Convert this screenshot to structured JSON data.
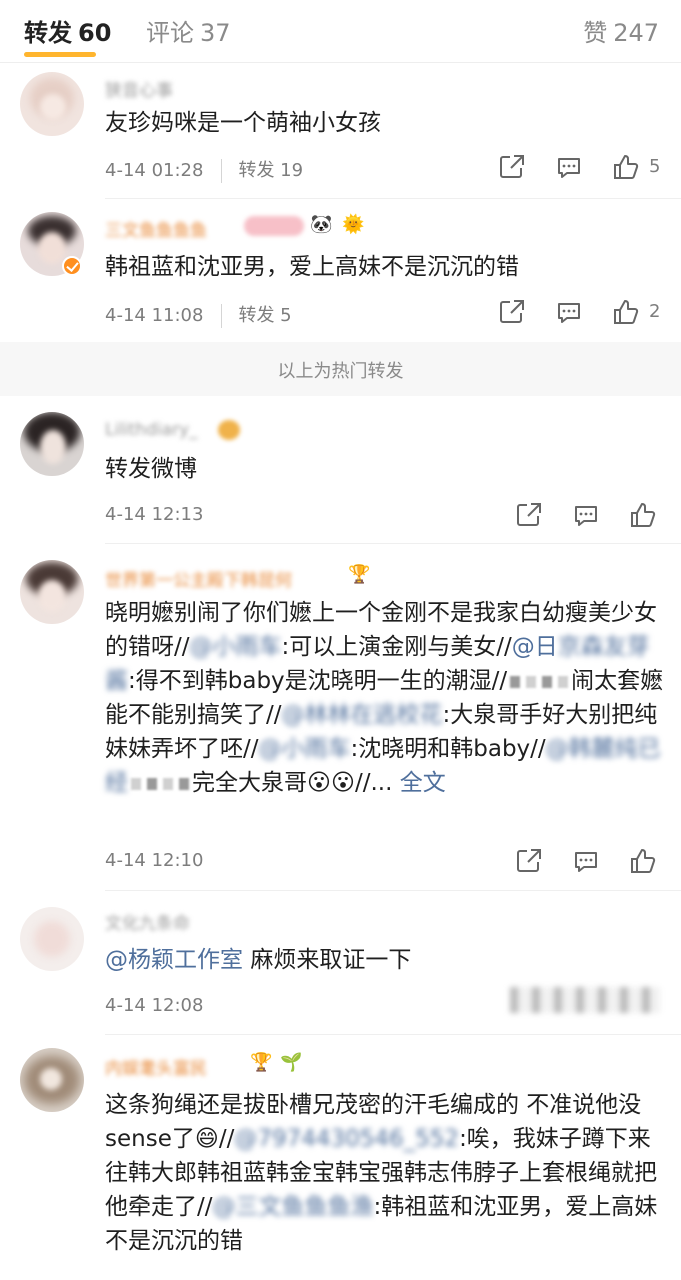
{
  "tabs": {
    "repost_label": "转发",
    "repost_count": "60",
    "comment_label": "评论",
    "comment_count": "37",
    "like_label": "赞",
    "like_count": "247"
  },
  "section_label": "以上为热门转发",
  "colors": {
    "accent_underline": "#ffb52e",
    "mention_blue": "#4f6f9c",
    "meta_gray": "#7d7d7d",
    "verified_orange": "#ff8f1f"
  },
  "posts": [
    {
      "username": "狭音心事",
      "text": "友珍妈咪是一个萌袖小女孩",
      "time": "4-14 01:28",
      "repost": "转发 19",
      "likes": "5"
    },
    {
      "username": "三文鱼鱼鱼鱼",
      "text": "韩祖蓝和沈亚男，爱上高妹不是沉沉的错",
      "time": "4-14 11:08",
      "repost": "转发 5",
      "likes": "2"
    },
    {
      "username": "Lilithdiary_",
      "text": "转发微博",
      "time": "4-14 12:13"
    },
    {
      "username": "世界第一公主殿下韩昆何",
      "text_parts": {
        "p1": "晓明嬷别闹了你们嬷上一个金刚不是我家白幼瘦美少女的错呀//",
        "m1": "@小雨车",
        "p2": ":可以上演金刚与美女//",
        "m2a": "@日",
        "m2b": "京森友芽酱",
        "p3": ":得不到韩baby是沈晓明一生的潮湿//",
        "p4": "闹太套嬷能不能别搞笑了//",
        "m3a": "@林林在逃校",
        "m3b": "花",
        "p5": ":大泉哥手好大别把纯妹妹弄坏了呸//",
        "m4": "@小雨车",
        "p6": ":沈晓明和韩baby//",
        "m5": "@韩麓纯已经",
        "p7": "完全大泉哥",
        "p8": "//...",
        "fulltext": "全文"
      },
      "time": "4-14 12:10"
    },
    {
      "username": "文化九条命",
      "mention": "@杨颖工作室",
      "text": "麻烦来取证一下",
      "time": "4-14 12:08"
    },
    {
      "username": "内娱耄头富民",
      "text_parts": {
        "p1": "这条狗绳还是拔卧槽兄茂密的汗毛编成的 不准说他没sense了",
        "p2": "//",
        "m1": "@7974430546_552",
        "p3": ":唉，我妹子蹲下来往韩大郎韩祖蓝韩金宝韩宝强韩志伟脖子上套根绳就把他牵走了//",
        "m2": "@三文鱼鱼鱼渔",
        "p4": ":韩祖蓝和沈亚男，爱上高妹不是沉沉的错"
      }
    }
  ],
  "icons": {
    "share": "share-icon",
    "comment": "comment-icon",
    "like": "thumbs-up-icon"
  }
}
